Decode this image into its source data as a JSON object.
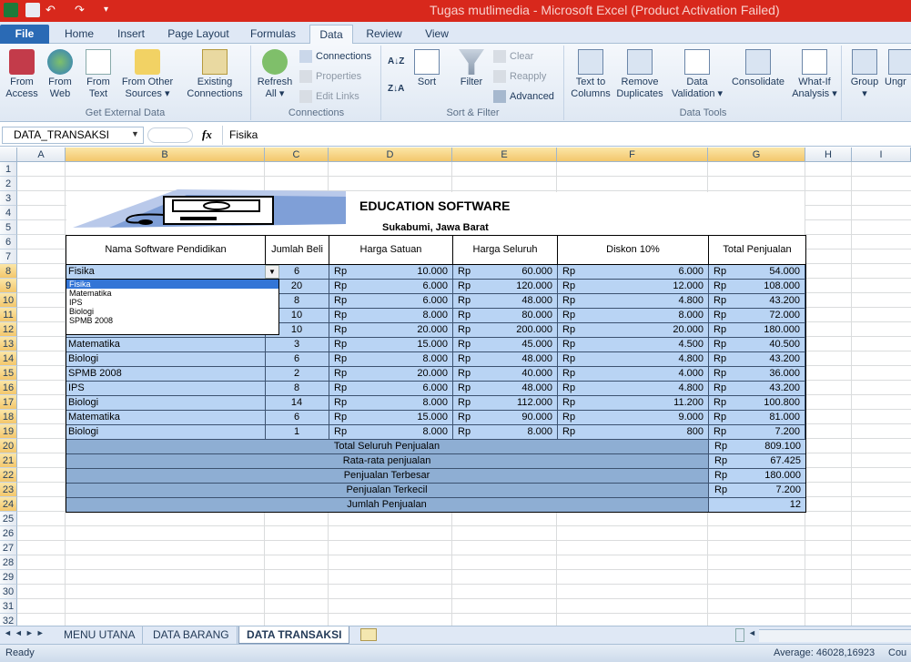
{
  "window": {
    "title": "Tugas mutlimedia  -  Microsoft Excel (Product Activation Failed)"
  },
  "ribbon_tabs": [
    "File",
    "Home",
    "Insert",
    "Page Layout",
    "Formulas",
    "Data",
    "Review",
    "View"
  ],
  "ribbon": {
    "get_external": {
      "access": "From\nAccess",
      "web": "From\nWeb",
      "text": "From\nText",
      "other": "From Other\nSources ▾",
      "existing": "Existing\nConnections",
      "label": "Get External Data"
    },
    "connections": {
      "refresh": "Refresh\nAll ▾",
      "connections": "Connections",
      "properties": "Properties",
      "edit_links": "Edit Links",
      "label": "Connections"
    },
    "sort_filter": {
      "sort": "Sort",
      "filter": "Filter",
      "clear": "Clear",
      "reapply": "Reapply",
      "advanced": "Advanced",
      "label": "Sort & Filter"
    },
    "data_tools": {
      "text_to_columns": "Text to\nColumns",
      "remove_dup": "Remove\nDuplicates",
      "validation": "Data\nValidation ▾",
      "consolidate": "Consolidate",
      "whatif": "What-If\nAnalysis ▾",
      "label": "Data Tools"
    },
    "outline": {
      "group": "Group\n▾",
      "ungroup": "Ungr"
    }
  },
  "formula_bar": {
    "name_box": "DATA_TRANSAKSI",
    "fx": "fx",
    "value": "Fisika"
  },
  "columns": [
    "A",
    "B",
    "C",
    "D",
    "E",
    "F",
    "G",
    "H",
    "I"
  ],
  "rows": [
    "1",
    "2",
    "3",
    "4",
    "5",
    "6",
    "7",
    "8",
    "9",
    "10",
    "11",
    "12",
    "13",
    "14",
    "15",
    "16",
    "17",
    "18",
    "19",
    "20",
    "21",
    "22",
    "23",
    "24",
    "25",
    "26",
    "27",
    "28",
    "29",
    "30",
    "31",
    "32"
  ],
  "sheet": {
    "title": "EDUCATION SOFTWARE",
    "subtitle": "Sukabumi, Jawa Barat",
    "headers": [
      "Nama Software Pendidikan",
      "Jumlah Beli",
      "Harga Satuan",
      "Harga Seluruh",
      "Diskon 10%",
      "Total Penjualan"
    ],
    "currency": "Rp",
    "data": [
      [
        "Fisika",
        "6",
        "10.000",
        "60.000",
        "6.000",
        "54.000"
      ],
      [
        "",
        "20",
        "6.000",
        "120.000",
        "12.000",
        "108.000"
      ],
      [
        "",
        "8",
        "6.000",
        "48.000",
        "4.800",
        "43.200"
      ],
      [
        "",
        "10",
        "8.000",
        "80.000",
        "8.000",
        "72.000"
      ],
      [
        "",
        "10",
        "20.000",
        "200.000",
        "20.000",
        "180.000"
      ],
      [
        "Matematika",
        "3",
        "15.000",
        "45.000",
        "4.500",
        "40.500"
      ],
      [
        "Biologi",
        "6",
        "8.000",
        "48.000",
        "4.800",
        "43.200"
      ],
      [
        "SPMB 2008",
        "2",
        "20.000",
        "40.000",
        "4.000",
        "36.000"
      ],
      [
        "IPS",
        "8",
        "6.000",
        "48.000",
        "4.800",
        "43.200"
      ],
      [
        "Biologi",
        "14",
        "8.000",
        "112.000",
        "11.200",
        "100.800"
      ],
      [
        "Matematika",
        "6",
        "15.000",
        "90.000",
        "9.000",
        "81.000"
      ],
      [
        "Biologi",
        "1",
        "8.000",
        "8.000",
        "800",
        "7.200"
      ]
    ],
    "summary": [
      {
        "label": "Total Seluruh Penjualan",
        "rp": "Rp",
        "value": "809.100"
      },
      {
        "label": "Rata-rata penjualan",
        "rp": "Rp",
        "value": "67.425"
      },
      {
        "label": "Penjualan Terbesar",
        "rp": "Rp",
        "value": "180.000"
      },
      {
        "label": "Penjualan Terkecil",
        "rp": "Rp",
        "value": "7.200"
      },
      {
        "label": "Jumlah Penjualan",
        "rp": "",
        "value": "12"
      }
    ],
    "dropdown_options": [
      "Fisika",
      "Matematika",
      "IPS",
      "Biologi",
      "SPMB 2008"
    ]
  },
  "sheet_tabs": [
    "MENU UTANA",
    "DATA BARANG",
    "DATA TRANSAKSI"
  ],
  "status": {
    "ready": "Ready",
    "average": "Average: 46028,16923",
    "count": "Cou"
  }
}
